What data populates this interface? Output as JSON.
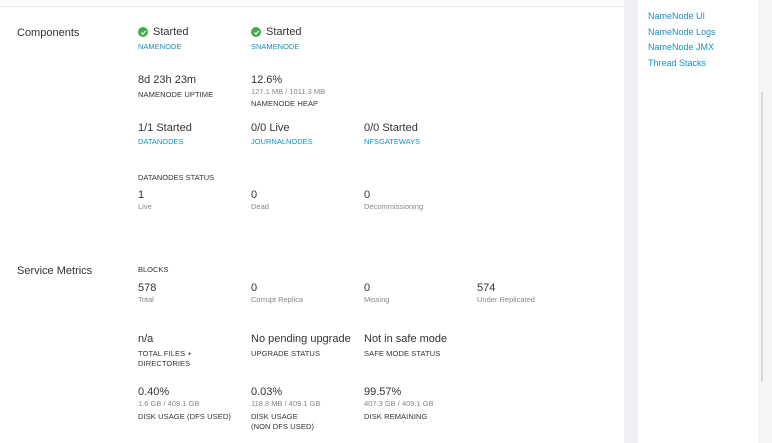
{
  "sidebar_links": [
    "NameNode UI",
    "NameNode Logs",
    "NameNode JMX",
    "Thread Stacks"
  ],
  "colors": {
    "accent": "#1491c1",
    "started": "#3fae49"
  },
  "components": {
    "title": "Components",
    "namenode": {
      "status": "Started",
      "label": "NAMENODE",
      "icon": "check-circle-icon"
    },
    "snamenode": {
      "status": "Started",
      "label": "SNAMENODE",
      "icon": "check-circle-icon"
    },
    "uptime": {
      "value": "8d 23h 23m",
      "label": "NAMENODE UPTIME"
    },
    "heap": {
      "value": "12.6%",
      "detail": "127.1 MB / 1011.3 MB",
      "label": "NAMENODE HEAP"
    },
    "datanodes": {
      "value": "1/1 Started",
      "label": "DATANODES"
    },
    "journalnodes": {
      "value": "0/0 Live",
      "label": "JOURNALNODES"
    },
    "nfsgateways": {
      "value": "0/0 Started",
      "label": "NFSGATEWAYS"
    },
    "datanodes_status": {
      "header": "DATANODES STATUS",
      "live": {
        "value": "1",
        "label": "Live"
      },
      "dead": {
        "value": "0",
        "label": "Dead"
      },
      "decommissioning": {
        "value": "0",
        "label": "Decommissioning"
      }
    }
  },
  "service_metrics": {
    "title": "Service Metrics",
    "blocks_header": "BLOCKS",
    "total": {
      "value": "578",
      "label": "Total"
    },
    "corrupt": {
      "value": "0",
      "label": "Corrupt Replica"
    },
    "missing": {
      "value": "0",
      "label": "Missing"
    },
    "under_replicated": {
      "value": "574",
      "label": "Under Replicated"
    },
    "files": {
      "value": "n/a",
      "label": "TOTAL FILES + DIRECTORIES"
    },
    "upgrade": {
      "value": "No pending upgrade",
      "label": "UPGRADE STATUS"
    },
    "safe_mode": {
      "value": "Not in safe mode",
      "label": "SAFE MODE STATUS"
    },
    "disk_dfs": {
      "value": "0.40%",
      "detail": "1.6 GB / 409.1 GB",
      "label": "DISK USAGE (DFS USED)"
    },
    "disk_non_dfs": {
      "value": "0.03%",
      "detail": "118.8 MB / 409.1 GB",
      "label": "DISK USAGE (NON DFS USED)"
    },
    "disk_remaining": {
      "value": "99.57%",
      "detail": "407.3 GB / 409.1 GB",
      "label": "DISK REMAINING"
    }
  }
}
